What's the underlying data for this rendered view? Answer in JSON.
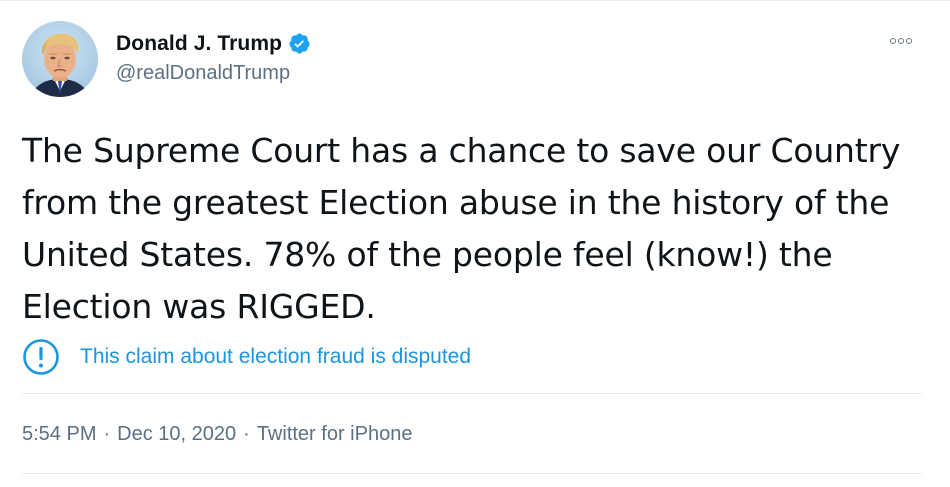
{
  "author": {
    "display_name": "Donald J. Trump",
    "handle": "@realDonaldTrump",
    "verified": true,
    "avatar_icon": "profile-photo"
  },
  "tweet": {
    "text": "The Supreme Court has a chance to save our Country\nfrom the greatest Election abuse in the history of the\nUnited States. 78% of the people feel (know!) the\nElection was RIGGED.",
    "label": "This claim about election fraud is disputed",
    "time": "5:54 PM",
    "date": "Dec 10, 2020",
    "source": "Twitter for iPhone",
    "separator": "·"
  },
  "colors": {
    "accent": "#1b95e0",
    "verified": "#1da1f2",
    "muted": "#5b7083",
    "text": "#0f1419"
  },
  "icons": {
    "more": "more-dots-icon",
    "label": "exclamation-circle-icon",
    "verified": "verified-badge-icon"
  }
}
